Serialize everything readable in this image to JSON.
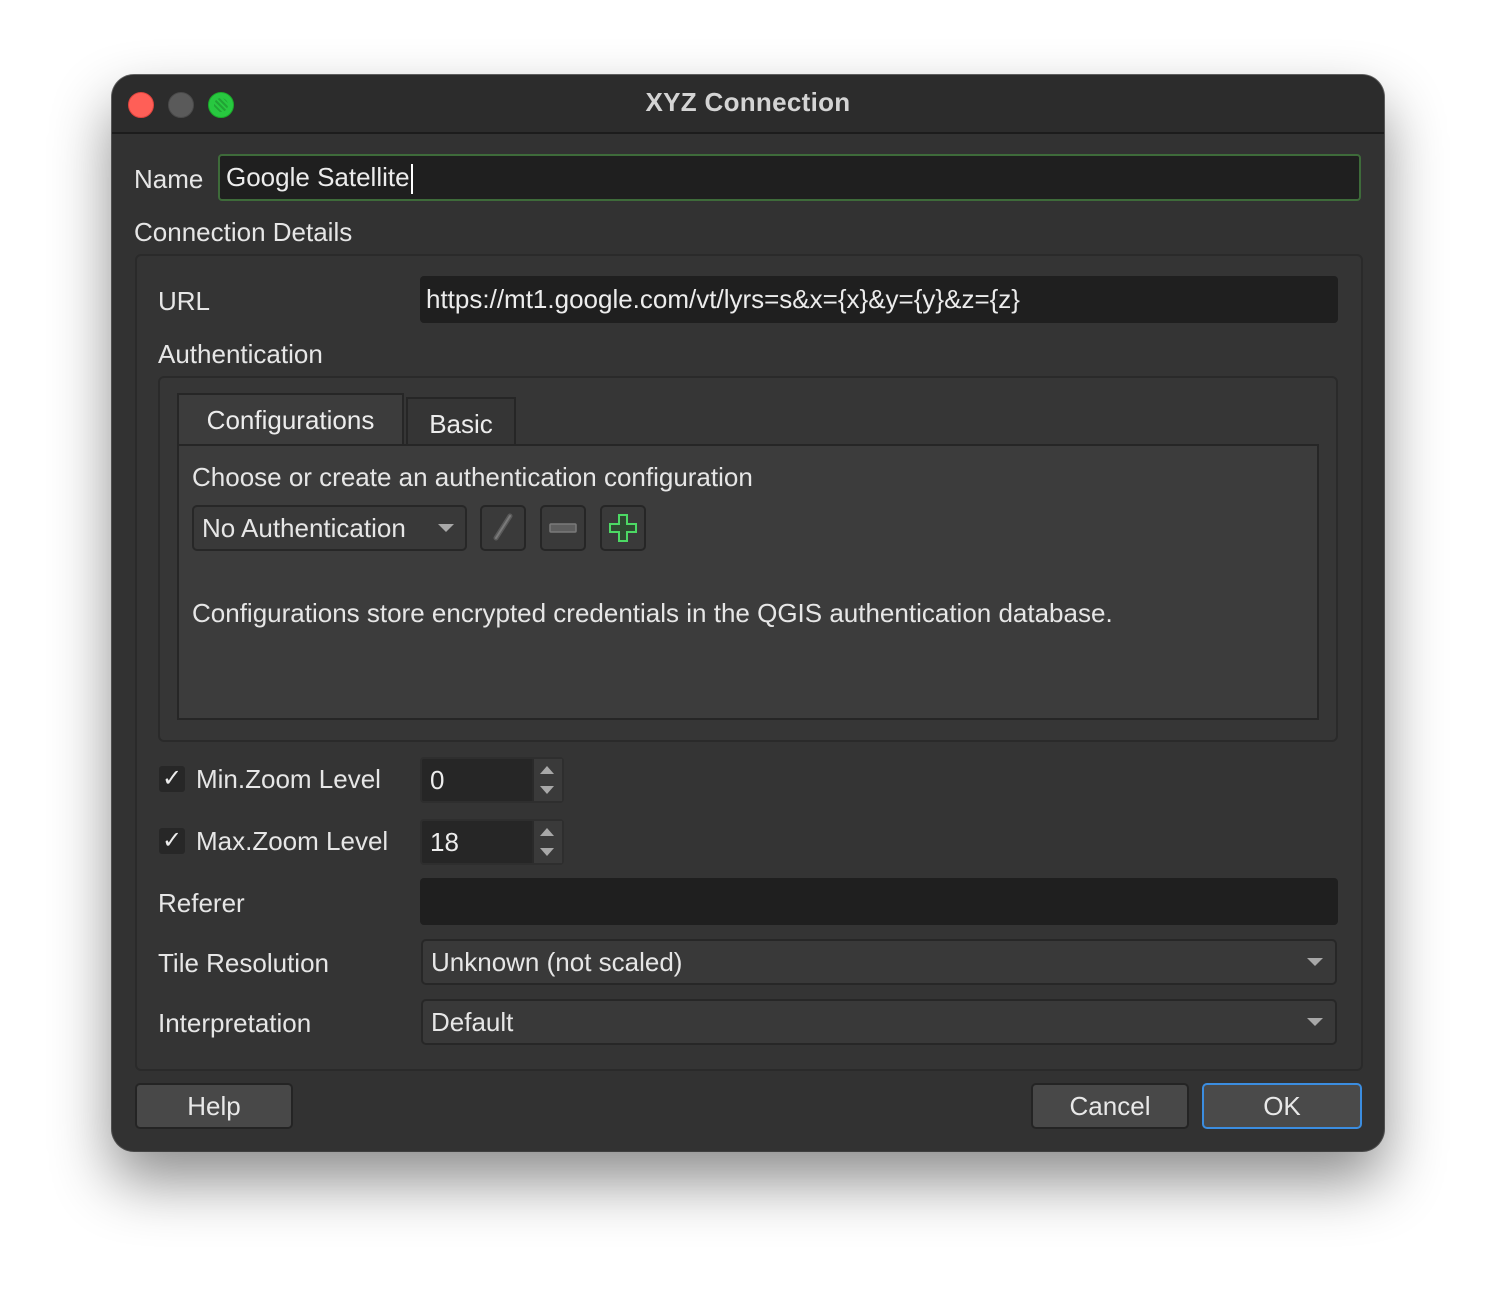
{
  "window": {
    "title": "XYZ Connection"
  },
  "name": {
    "label": "Name",
    "value": "Google Satellite"
  },
  "connection_details": {
    "label": "Connection Details",
    "url_label": "URL",
    "url_value": "https://mt1.google.com/vt/lyrs=s&x={x}&y={y}&z={z}",
    "authentication_label": "Authentication",
    "tabs": [
      {
        "label": "Configurations",
        "active": true
      },
      {
        "label": "Basic",
        "active": false
      }
    ],
    "auth_prompt": "Choose or create an authentication configuration",
    "auth_selected": "No Authentication",
    "auth_info": "Configurations store encrypted credentials in the QGIS authentication database.",
    "toolbar_icons": [
      "edit-icon",
      "remove-icon",
      "add-icon"
    ],
    "min_zoom": {
      "label": "Min.Zoom Level",
      "checked": true,
      "value": "0"
    },
    "max_zoom": {
      "label": "Max.Zoom Level",
      "checked": true,
      "value": "18"
    },
    "referer_label": "Referer",
    "referer_value": "",
    "tile_resolution_label": "Tile Resolution",
    "tile_resolution_value": "Unknown (not scaled)",
    "interpretation_label": "Interpretation",
    "interpretation_value": "Default"
  },
  "buttons": {
    "help": "Help",
    "cancel": "Cancel",
    "ok": "OK"
  },
  "colors": {
    "close": "#ff5f57",
    "zoom": "#28c840",
    "default_button_border": "#3b8de0",
    "add_icon": "#4cd964"
  }
}
